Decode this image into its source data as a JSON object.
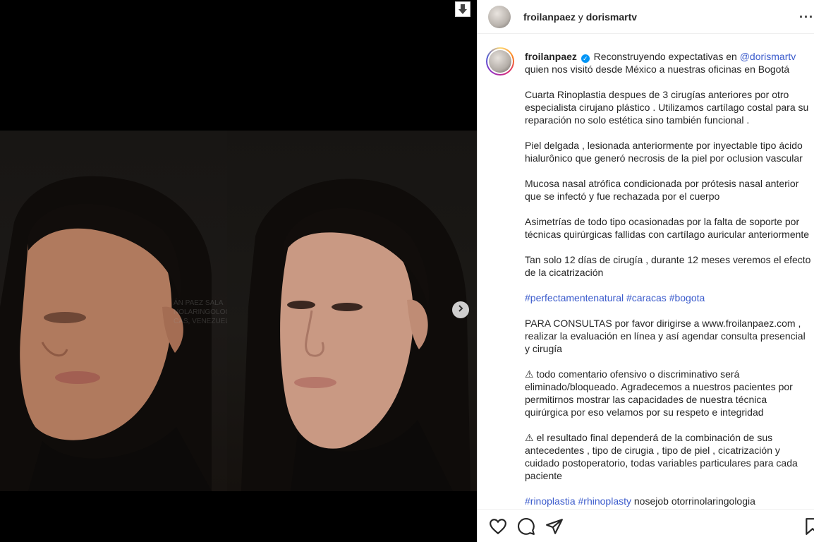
{
  "header": {
    "user1": "froilanpaez",
    "joiner": " y ",
    "user2": "dorismartv",
    "more": "···"
  },
  "watermark": "ÁN PAEZ SALA\nNOLARINGOLOG\nCAS, VENEZUEL",
  "caption": {
    "username": "froilanpaez",
    "verified_glyph": "✓",
    "intro": " Reconstruyendo expectativas en ",
    "mention": "@dorismartv",
    "intro2": "quien nos visitó desde México a nuestras oficinas en Bogotá",
    "p1": "Cuarta Rinoplastia despues de 3 cirugías anteriores por otro especialista cirujano plástico . Utilizamos cartílago costal para su reparación no solo estética sino también funcional .",
    "p2": "Piel delgada , lesionada anteriormente por inyectable tipo ácido hialurônico que generó necrosis de la piel por oclusion vascular",
    "p3": "Mucosa nasal atrófica condicionada por prótesis nasal anterior que se infectó y fue rechazada por el cuerpo",
    "p4": "Asimetrías de todo tipo ocasionadas por la falta de soporte por técnicas quirúrgicas fallidas con cartílago auricular anteriormente",
    "p5": "Tan solo 12 días de cirugía , durante 12 meses veremos el efecto de la cicatrización",
    "tags1": [
      "#perfectamentenatural",
      "#caracas",
      "#bogota"
    ],
    "p6": "PARA CONSULTAS por favor dirigirse a www.froilanpaez.com , realizar la evaluación en línea y así agendar consulta presencial y cirugía",
    "warn_glyph": "⚠",
    "p7": " todo comentario ofensivo o discriminativo será eliminado/bloqueado. Agradecemos a nuestros pacientes por permitirnos mostrar las capacidades de nuestra técnica quirúrgica por eso velamos por su respeto e integridad",
    "p8": " el resultado final dependerá de la combinación de sus antecedentes , tipo de cirugia , tipo de piel , cicatrización y cuidado postoperatorio, todas variables particulares para cada paciente",
    "tags2": [
      "#rinoplastia",
      "#rhinoplasty"
    ],
    "tags2_tail": " nosejob otorrinolaringologia"
  },
  "colors": {
    "link": "#3b5bcc",
    "text": "#262626",
    "verified": "#0095f6"
  },
  "icons": [
    "download-icon",
    "chevron-right-icon",
    "heart-icon",
    "comment-icon",
    "share-icon",
    "bookmark-icon",
    "more-icon",
    "verified-icon",
    "warning-icon"
  ]
}
